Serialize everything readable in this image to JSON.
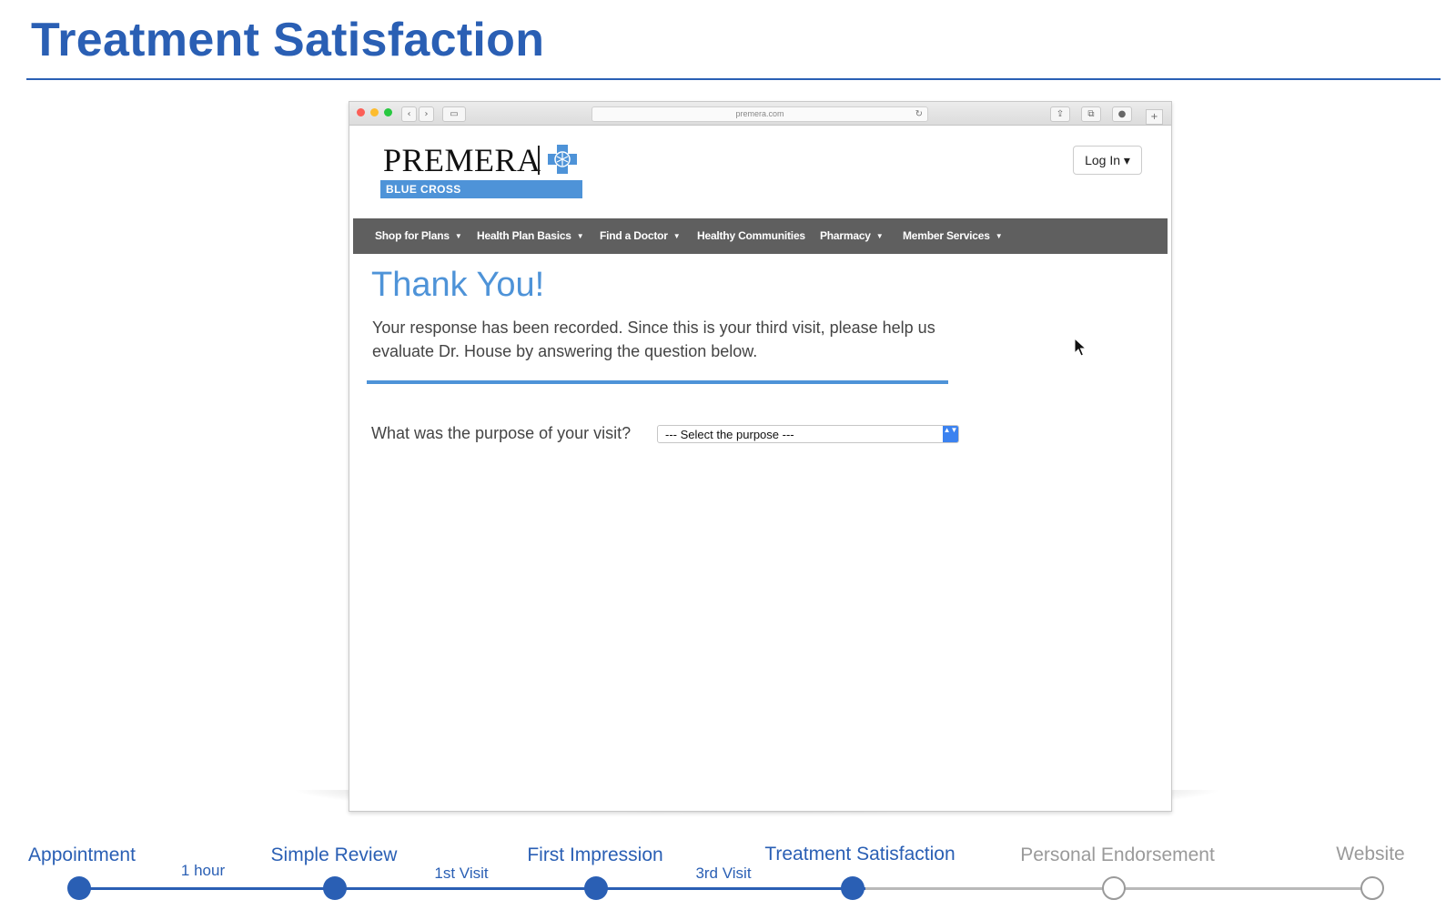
{
  "slide": {
    "title": "Treatment Satisfaction"
  },
  "browser": {
    "url": "premera.com",
    "back_icon": "‹",
    "forward_icon": "›",
    "sidebar_icon": "▭",
    "share_icon": "⇪",
    "tabs_icon": "⧉",
    "download_icon": "●",
    "newtab_icon": "+",
    "reload_icon": "↻"
  },
  "site": {
    "logo_word": "PREMERA",
    "logo_band": "BLUE CROSS",
    "login_label": "Log In ▾",
    "nav": [
      {
        "label": "Shop for Plans",
        "caret": "▼"
      },
      {
        "label": "Health Plan Basics",
        "caret": "▼"
      },
      {
        "label": "Find a Doctor",
        "caret": "▼"
      },
      {
        "label": "Healthy Communities",
        "caret": ""
      },
      {
        "label": "Pharmacy",
        "caret": "▼"
      },
      {
        "label": "Member Services",
        "caret": "▼"
      }
    ],
    "heading": "Thank You!",
    "message": "Your response has been recorded. Since this is your third visit, please help us evaluate Dr. House by answering the question below.",
    "question": "What was the purpose of your visit?",
    "select_value": "--- Select the purpose ---",
    "select_arrows": "▲▼",
    "colors": {
      "accent": "#4e93d8",
      "nav_bg": "#5f5f5f",
      "select_arrow": "#3b82f0"
    }
  },
  "timeline": {
    "steps": [
      {
        "label": "Appointment",
        "state": "done"
      },
      {
        "label": "Simple Review",
        "state": "done"
      },
      {
        "label": "First Impression",
        "state": "done"
      },
      {
        "label": "Treatment Satisfaction",
        "state": "done"
      },
      {
        "label": "Personal Endorsement",
        "state": "todo"
      },
      {
        "label": "Website",
        "state": "todo"
      }
    ],
    "gaps": [
      "1 hour",
      "1st Visit",
      "3rd Visit"
    ],
    "colors": {
      "done": "#2a5fb4",
      "todo": "#9a9a9a"
    }
  }
}
